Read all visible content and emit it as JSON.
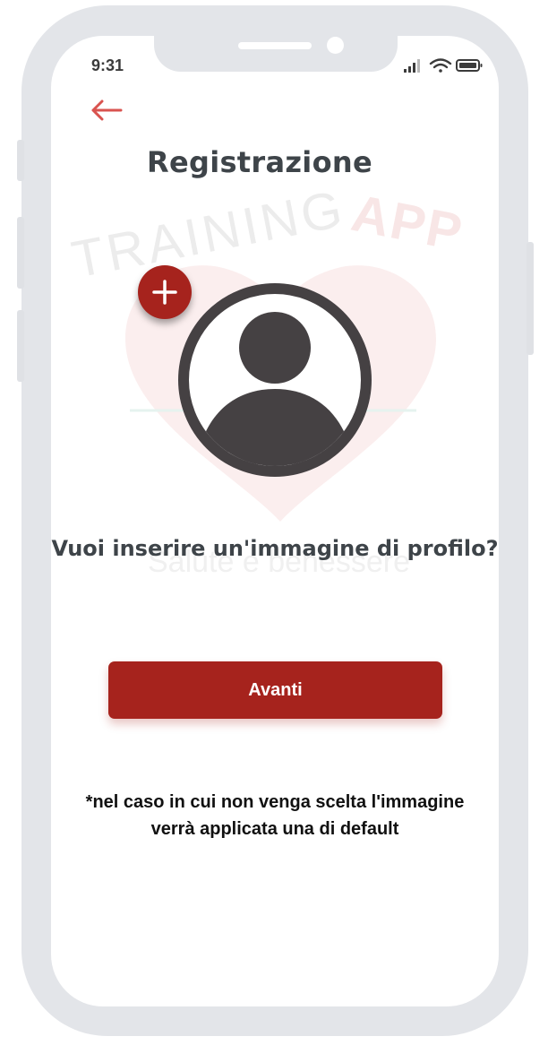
{
  "status_bar": {
    "time": "9:31",
    "icons": [
      "signal-icon",
      "wifi-icon",
      "battery-icon"
    ]
  },
  "nav": {
    "back_icon": "arrow-left-icon"
  },
  "header": {
    "title": "Registrazione"
  },
  "watermark": {
    "brand_text_1": "TRAINING",
    "brand_text_2": "APP",
    "tagline": "Salute e benessere"
  },
  "profile": {
    "avatar_icon": "user-avatar-icon",
    "add_icon": "plus-icon",
    "question": "Vuoi inserire un'immagine di profilo?"
  },
  "actions": {
    "next_label": "Avanti"
  },
  "note": {
    "line1": "*nel caso in cui non venga scelta l'immagine",
    "line2": "verrà applicata una di default"
  },
  "colors": {
    "accent": "#a6231d",
    "back_arrow": "#d9534f",
    "text_dark": "#3e4449",
    "icon_dark": "#454143",
    "frame": "#e3e5e9"
  }
}
